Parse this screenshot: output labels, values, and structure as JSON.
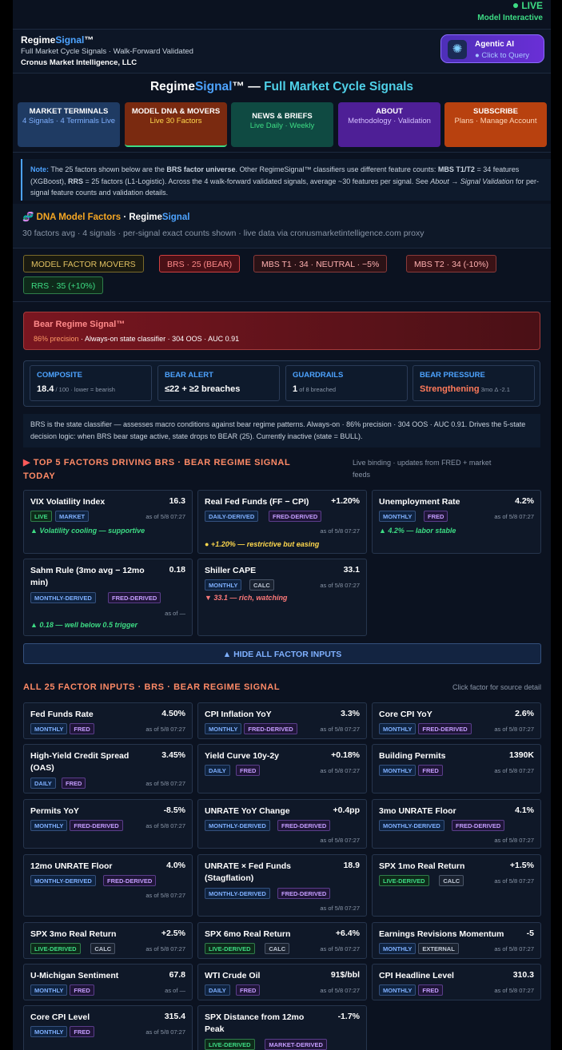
{
  "status": {
    "live": "LIVE",
    "model": "Model Interactive"
  },
  "brand": {
    "name_a": "Regime",
    "name_b": "Signal",
    "name_c": "™",
    "subtitle": "Full Market Cycle Signals · Walk-Forward Validated",
    "company": "Cronus Market Intelligence, LLC"
  },
  "agentic": {
    "title": "Agentic AI",
    "sub": "● Click to Query",
    "icon": "brain-icon"
  },
  "headline": {
    "a": "Regime",
    "b": "Signal",
    "c": "™ — ",
    "d": "Full Market Cycle Signals"
  },
  "nav": [
    {
      "l1": "MARKET TERMINALS",
      "l2": "4 Signals · 4 Terminals Live",
      "bg": "#1f3b63",
      "fg": "#7fb0ff"
    },
    {
      "l1": "MODEL DNA & MOVERS",
      "l2": "Live 30 Factors",
      "bg": "#7a2a10",
      "fg": "#ffd84d"
    },
    {
      "l1": "NEWS & BRIEFS",
      "l2": "Live Daily · Weekly",
      "bg": "#0f4a42",
      "fg": "#3ddc84"
    },
    {
      "l1": "ABOUT",
      "l2": "Methodology · Validation",
      "bg": "#4e1f96",
      "fg": "#d4bfff"
    },
    {
      "l1": "SUBSCRIBE",
      "l2": "Plans · Manage Account",
      "bg": "#b8410f",
      "fg": "#ffd6b8"
    }
  ],
  "note": {
    "label": "Note:",
    "t1": " The 25 factors shown below are the ",
    "b1": "BRS factor universe",
    "t2": ". Other RegimeSignal™ classifiers use different feature counts: ",
    "b2": "MBS T1/T2",
    "t3": " = 34 features (XGBoost), ",
    "b3": "RRS",
    "t4": " = 25 factors (L1-Logistic). Across the 4 walk-forward validated signals, average ~30 features per signal. See ",
    "i1": "About → Signal Validation",
    "t5": " for per-signal feature counts and validation details."
  },
  "dna": {
    "icon": "dna-icon",
    "h1": "DNA Model Factors",
    "h2": " · Regime",
    "h3": "Signal",
    "sub": "30 factors avg · 4 signals · per-signal exact counts shown · live data via cronusmarketintelligence.com proxy"
  },
  "pills": [
    "MODEL FACTOR MOVERS",
    "BRS · 25 (BEAR)",
    "MBS T1 · 34 · NEUTRAL · −5%",
    "MBS T2 · 34 (-10%)",
    "RRS · 35 (+10%)"
  ],
  "alert": {
    "title": "Bear Regime Signal™",
    "precision": "86% precision",
    "rest": " · Always-on state classifier · 304 OOS · AUC 0.91"
  },
  "metrics": [
    {
      "label": "COMPOSITE",
      "value": "18.4",
      "small": " / 100 · lower = bearish"
    },
    {
      "label": "BEAR ALERT",
      "value": "≤22 + ≥2 breaches",
      "small": ""
    },
    {
      "label": "GUARDRAILS",
      "value": "1",
      "small": " of 8 breached"
    },
    {
      "label": "BEAR PRESSURE",
      "value": "Strengthening",
      "small": " 3mo Δ -2.1"
    }
  ],
  "desc": "BRS is the state classifier — assesses macro conditions against bear regime patterns. Always-on · 86% precision · 304 OOS · AUC 0.91. Drives the 5-state decision logic: when BRS bear stage active, state drops to BEAR (25). Currently inactive (state = BULL).",
  "top5": {
    "title_tri": "▶",
    "title1": " TOP 5 FACTORS DRIVING BRS · BEAR REGIME SIGNAL",
    "title2": "TODAY",
    "note1": "Live binding · updates from FRED + market",
    "note2": "feeds",
    "cards": [
      {
        "name": "VIX Volatility Index",
        "value": "16.3",
        "tags": [
          "LIVE",
          "MARKET"
        ],
        "asof": "as of 5/8 07:27",
        "status": "▲ Volatility cooling — supportive",
        "scolor": "#3ddc84"
      },
      {
        "name": "Real Fed Funds (FF − CPI)",
        "value": "+1.20%",
        "tags": [
          "DAILY-DERIVED",
          "FRED-DERIVED"
        ],
        "asof": "as of 5/8 07:27",
        "status": "● +1.20% — restrictive but easing",
        "scolor": "#ffd84d"
      },
      {
        "name": "Unemployment Rate",
        "value": "4.2%",
        "tags": [
          "MONTHLY",
          "FRED"
        ],
        "asof": "as of 5/8 07:27",
        "status": "▲ 4.2% — labor stable",
        "scolor": "#3ddc84"
      },
      {
        "name": "Sahm Rule (3mo avg − 12mo min)",
        "name1": "Sahm Rule (3mo avg − 12mo",
        "name2": "min)",
        "value": "0.18",
        "tags": [
          "MONTHLY-DERIVED",
          "FRED-DERIVED"
        ],
        "asof": "as of —",
        "status": "▲ 0.18 — well below 0.5 trigger",
        "scolor": "#3ddc84"
      },
      {
        "name": "Shiller CAPE",
        "value": "33.1",
        "tags": [
          "MONTHLY",
          "CALC"
        ],
        "asof": "as of 5/8 07:27",
        "status": "▼ 33.1 — rich, watching",
        "scolor": "#ff7a7a"
      }
    ]
  },
  "hide_button": "▲ HIDE ALL FACTOR INPUTS",
  "all25": {
    "title": "ALL 25 FACTOR INPUTS · BRS · BEAR REGIME SIGNAL",
    "note": "Click factor for source detail",
    "cards": [
      {
        "name": "Fed Funds Rate",
        "value": "4.50%",
        "tags": [
          "MONTHLY",
          "FRED"
        ],
        "asof": "as of 5/8 07:27"
      },
      {
        "name": "CPI Inflation YoY",
        "value": "3.3%",
        "tags": [
          "MONTHLY",
          "FRED-DERIVED"
        ],
        "asof": "as of 5/8 07:27"
      },
      {
        "name": "Core CPI YoY",
        "value": "2.6%",
        "tags": [
          "MONTHLY",
          "FRED-DERIVED"
        ],
        "asof": "as of 5/8 07:27"
      },
      {
        "name1": "High-Yield Credit Spread",
        "name2": "(OAS)",
        "value": "3.45%",
        "tags": [
          "DAILY",
          "FRED"
        ],
        "asof": "as of 5/8 07:27"
      },
      {
        "name": "Yield Curve 10y-2y",
        "value": "+0.18%",
        "tags": [
          "DAILY",
          "FRED"
        ],
        "asof": "as of 5/8 07:27"
      },
      {
        "name": "Building Permits",
        "value": "1390K",
        "tags": [
          "MONTHLY",
          "FRED"
        ],
        "asof": "as of 5/8 07:27"
      },
      {
        "name": "Permits YoY",
        "value": "-8.5%",
        "tags": [
          "MONTHLY",
          "FRED-DERIVED"
        ],
        "asof": "as of 5/8 07:27"
      },
      {
        "name": "UNRATE YoY Change",
        "value": "+0.4pp",
        "tags": [
          "MONTHLY-DERIVED",
          "FRED-DERIVED"
        ],
        "asof": "as of 5/8 07:27"
      },
      {
        "name": "3mo UNRATE Floor",
        "value": "4.1%",
        "tags": [
          "MONTHLY-DERIVED",
          "FRED-DERIVED"
        ],
        "asof": "as of 5/8 07:27"
      },
      {
        "name": "12mo UNRATE Floor",
        "value": "4.0%",
        "tags": [
          "MONTHLY-DERIVED",
          "FRED-DERIVED"
        ],
        "asof": "as of 5/8 07:27"
      },
      {
        "name1": "UNRATE × Fed Funds",
        "name2": "(Stagflation)",
        "value": "18.9",
        "tags": [
          "MONTHLY-DERIVED",
          "FRED-DERIVED"
        ],
        "asof": "as of 5/8 07:27"
      },
      {
        "name": "SPX 1mo Real Return",
        "value": "+1.5%",
        "tags": [
          "LIVE-DERIVED",
          "CALC"
        ],
        "asof": "as of 5/8 07:27"
      },
      {
        "name": "SPX 3mo Real Return",
        "value": "+2.5%",
        "tags": [
          "LIVE-DERIVED",
          "CALC"
        ],
        "asof": "as of 5/8 07:27"
      },
      {
        "name": "SPX 6mo Real Return",
        "value": "+6.4%",
        "tags": [
          "LIVE-DERIVED",
          "CALC"
        ],
        "asof": "as of 5/8 07:27"
      },
      {
        "name": "Earnings Revisions Momentum",
        "value": "-5",
        "tags": [
          "MONTHLY",
          "EXTERNAL"
        ],
        "asof": "as of 5/8 07:27"
      },
      {
        "name": "U-Michigan Sentiment",
        "value": "67.8",
        "tags": [
          "MONTHLY",
          "FRED"
        ],
        "asof": "as of —"
      },
      {
        "name": "WTI Crude Oil",
        "value": "91$/bbl",
        "tags": [
          "DAILY",
          "FRED"
        ],
        "asof": "as of 5/8 07:27"
      },
      {
        "name": "CPI Headline Level",
        "value": "310.3",
        "tags": [
          "MONTHLY",
          "FRED"
        ],
        "asof": "as of 5/8 07:27"
      },
      {
        "name": "Core CPI Level",
        "value": "315.4",
        "tags": [
          "MONTHLY",
          "FRED"
        ],
        "asof": "as of 5/8 07:27"
      },
      {
        "name1": "SPX Distance from 12mo",
        "name2": "Peak",
        "value": "-1.7%",
        "tags": [
          "LIVE-DERIVED",
          "MARKET-DERIVED"
        ],
        "asof": ""
      }
    ]
  }
}
